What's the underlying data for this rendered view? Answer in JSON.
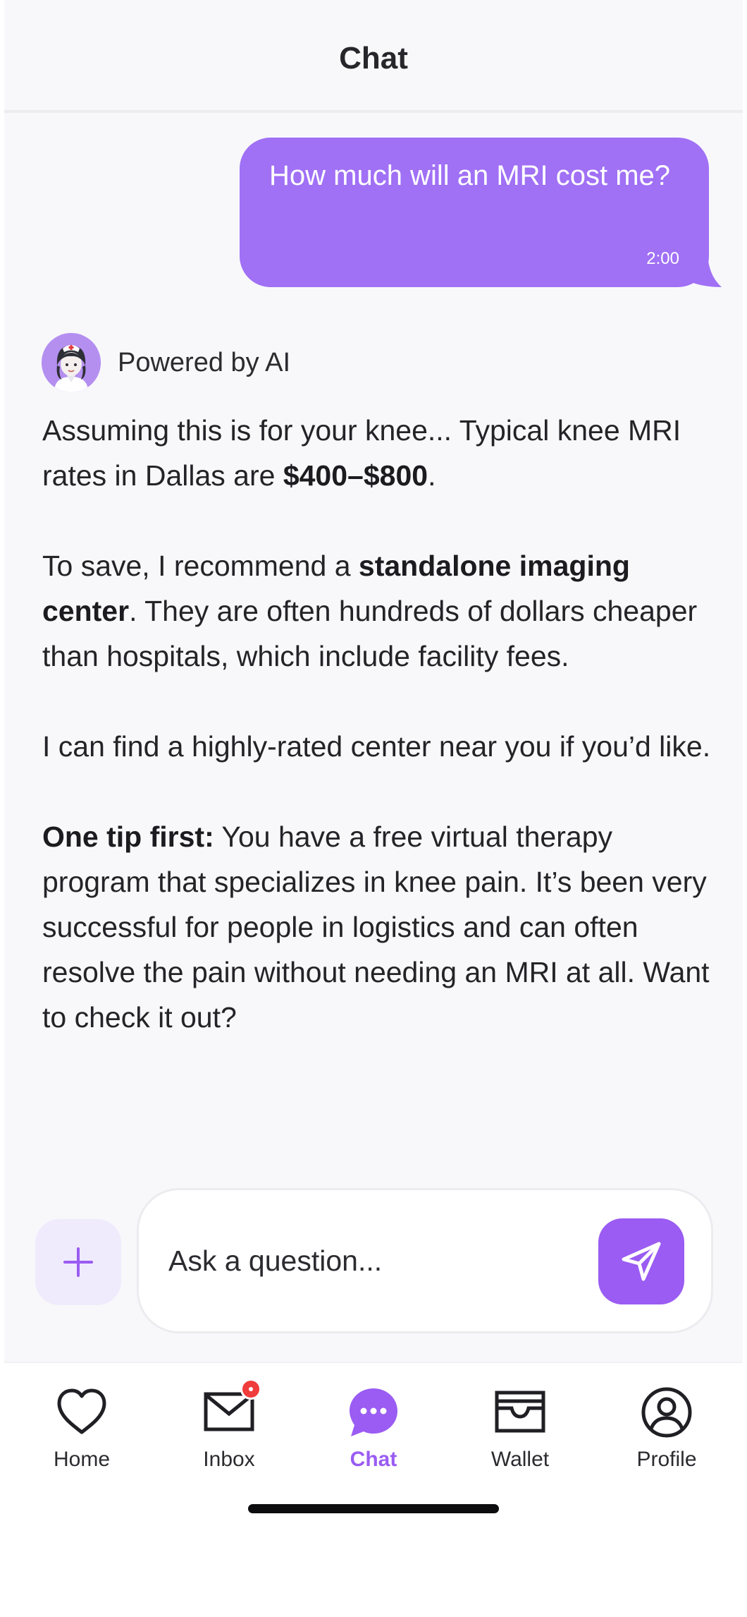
{
  "header": {
    "title": "Chat"
  },
  "user_message": {
    "text": "How much will an MRI cost me?",
    "time": "2:00"
  },
  "ai_sender": {
    "name": "Powered by AI",
    "avatar_icon": "nurse-avatar-icon"
  },
  "ai_message": {
    "p1_a": "Assuming this is for your knee... Typical knee MRI rates in Dallas are ",
    "p1_bold": "$400–$800",
    "p1_b": ".",
    "p2_a": "To save, I recommend a ",
    "p2_bold": "standalone imaging center",
    "p2_b": ". They are often hundreds of dollars cheaper than hospitals, which include facility fees.",
    "p3": "I can find a highly-rated center near you if you’d like.",
    "p4_bold": "One tip first:",
    "p4_b": " You have a free virtual therapy program that specializes in knee pain. It’s been very successful for people in logistics and can often resolve the pain without needing an MRI at all. Want to check it out?"
  },
  "composer": {
    "placeholder": "Ask a question...",
    "attach_icon": "plus-icon",
    "send_icon": "send-icon"
  },
  "tabs": [
    {
      "label": "Home",
      "icon": "heart-icon",
      "active": false
    },
    {
      "label": "Inbox",
      "icon": "mail-icon",
      "active": false,
      "has_badge": true
    },
    {
      "label": "Chat",
      "icon": "chat-bubble-icon",
      "active": true
    },
    {
      "label": "Wallet",
      "icon": "wallet-icon",
      "active": false
    },
    {
      "label": "Profile",
      "icon": "profile-icon",
      "active": false
    }
  ],
  "colors": {
    "accent": "#9a5cf2",
    "user_bubble": "#a070f5",
    "background": "#f8f8fb",
    "badge": "#f03c3c"
  }
}
